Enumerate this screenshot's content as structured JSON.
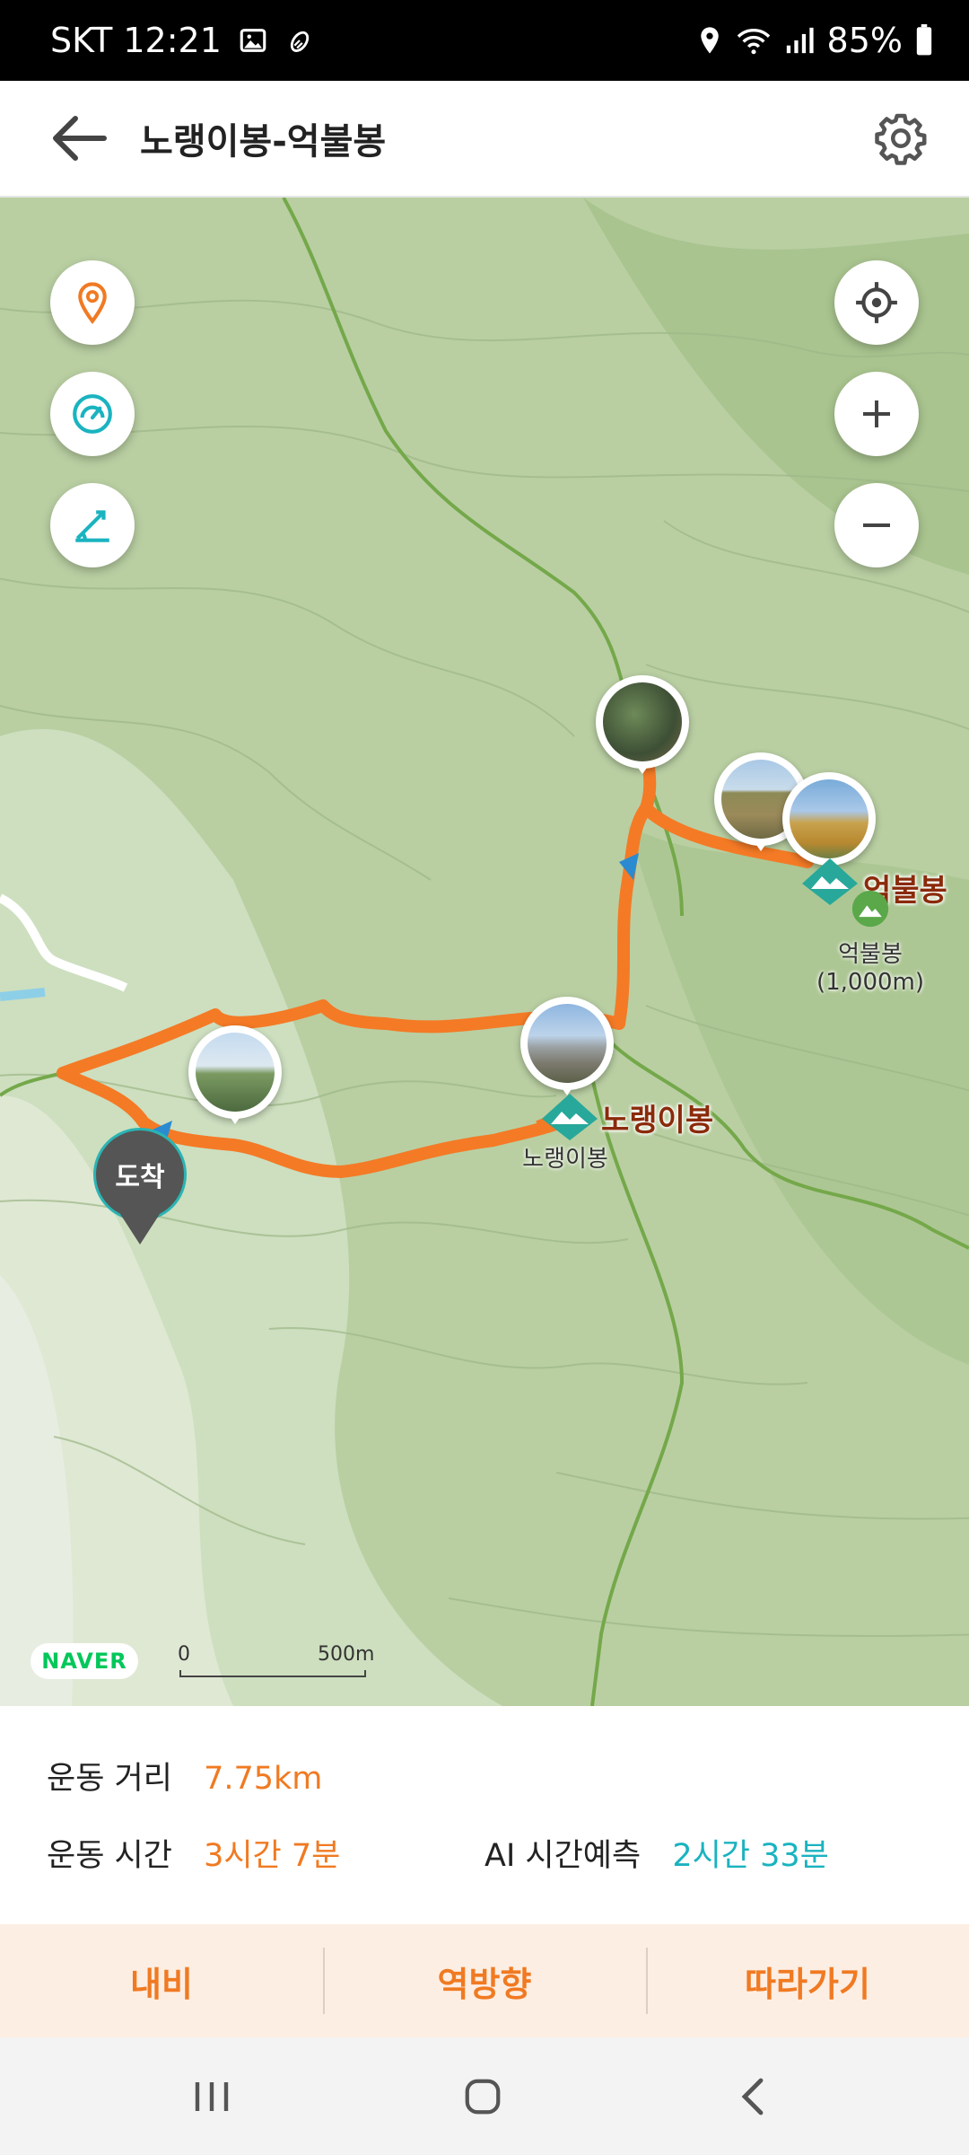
{
  "status_bar": {
    "carrier_time": "SKT 12:21",
    "battery": "85%"
  },
  "header": {
    "title": "노랭이봉-억불봉"
  },
  "map": {
    "arrive_label": "도착",
    "peaks": [
      {
        "name": "억불봉",
        "sub_name": "억불봉",
        "sub_height": "(1,000m)"
      },
      {
        "name": "노랭이봉",
        "sub_name": "노랭이봉"
      }
    ],
    "attribution": "NAVER",
    "scale": {
      "start": "0",
      "end": "500m"
    },
    "route_color": "#f47a26"
  },
  "stats": {
    "distance_label": "운동 거리",
    "distance_value": "7.75km",
    "time_label": "운동 시간",
    "time_value": "3시간 7분",
    "ai_label": "AI 시간예측",
    "ai_value": "2시간 33분"
  },
  "actions": {
    "navi": "내비",
    "reverse": "역방향",
    "follow": "따라가기"
  },
  "icons": [
    "image-icon",
    "walk-icon",
    "location-icon",
    "wifi-icon",
    "signal-icon",
    "battery-icon",
    "back-arrow-icon",
    "gear-icon",
    "map-pin-icon",
    "speedometer-icon",
    "elevation-icon",
    "crosshair-icon",
    "zoom-in-icon",
    "zoom-out-icon",
    "recent-apps-icon",
    "home-icon",
    "nav-back-icon"
  ]
}
